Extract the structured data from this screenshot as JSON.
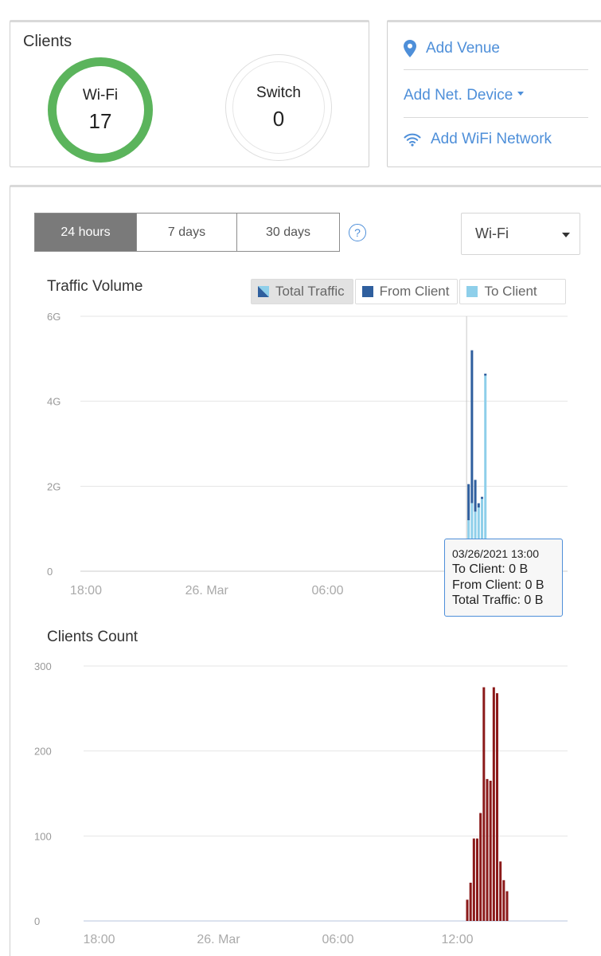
{
  "clients": {
    "title": "Clients",
    "wifi": {
      "label": "Wi-Fi",
      "count": "17",
      "color": "#5bb45c"
    },
    "switch": {
      "label": "Switch",
      "count": "0"
    }
  },
  "actions": {
    "add_venue": "Add Venue",
    "add_net_device": "Add Net. Device",
    "add_wifi_network": "Add WiFi Network",
    "link_color": "#4e8fd9"
  },
  "controls": {
    "tabs": [
      {
        "label": "24 hours",
        "active": true
      },
      {
        "label": "7 days",
        "active": false
      },
      {
        "label": "30 days",
        "active": false
      }
    ],
    "help": "?",
    "network_select": "Wi-Fi"
  },
  "traffic_chart": {
    "title": "Traffic Volume",
    "legend": [
      {
        "label": "Total Traffic",
        "active": true
      },
      {
        "label": "From Client",
        "color": "#2f5f9e"
      },
      {
        "label": "To Client",
        "color": "#8ecfea"
      }
    ],
    "tooltip": {
      "date": "03/26/2021 13:00",
      "to_client": "To Client: 0 B",
      "from_client": "From Client: 0 B",
      "total": "Total Traffic: 0 B"
    }
  },
  "clients_chart": {
    "title": "Clients Count"
  },
  "chart_data": [
    {
      "type": "bar",
      "title": "Traffic Volume",
      "x_unit": "hour",
      "x_axis_start": "2021-03-25 16:30",
      "x_ticks": [
        {
          "at": "2021-03-25 18:00",
          "label": "18:00"
        },
        {
          "at": "2021-03-26 00:00",
          "label": "26. Mar"
        },
        {
          "at": "2021-03-26 06:00",
          "label": "06:00"
        }
      ],
      "y_ticks": [
        {
          "value": 0,
          "label": "0"
        },
        {
          "value": 2,
          "label": "2G"
        },
        {
          "value": 4,
          "label": "4G"
        },
        {
          "value": 6,
          "label": "6G"
        }
      ],
      "ylim": [
        0,
        6
      ],
      "crosshair_at": "2021-03-26 13:00",
      "series": [
        {
          "name": "From Client",
          "color": "#2f5f9e",
          "points": [
            {
              "x": "2021-03-26 13:00",
              "y": 0.85
            },
            {
              "x": "2021-03-26 13:10",
              "y": 3.6
            },
            {
              "x": "2021-03-26 13:20",
              "y": 0.75
            },
            {
              "x": "2021-03-26 13:30",
              "y": 0.1
            },
            {
              "x": "2021-03-26 13:40",
              "y": 0.05
            },
            {
              "x": "2021-03-26 13:50",
              "y": 0.05
            }
          ]
        },
        {
          "name": "To Client",
          "color": "#8ecfea",
          "points": [
            {
              "x": "2021-03-26 13:00",
              "y": 1.2
            },
            {
              "x": "2021-03-26 13:10",
              "y": 1.6
            },
            {
              "x": "2021-03-26 13:20",
              "y": 1.4
            },
            {
              "x": "2021-03-26 13:30",
              "y": 1.5
            },
            {
              "x": "2021-03-26 13:40",
              "y": 1.7
            },
            {
              "x": "2021-03-26 13:50",
              "y": 4.6
            },
            {
              "x": "2021-03-26 14:00",
              "y": 0.3
            }
          ]
        }
      ]
    },
    {
      "type": "bar",
      "title": "Clients Count",
      "x_unit": "hour",
      "x_axis_start": "2021-03-25 16:30",
      "x_ticks": [
        {
          "at": "2021-03-25 18:00",
          "label": "18:00"
        },
        {
          "at": "2021-03-26 00:00",
          "label": "26. Mar"
        },
        {
          "at": "2021-03-26 06:00",
          "label": "06:00"
        },
        {
          "at": "2021-03-26 12:00",
          "label": "12:00"
        }
      ],
      "y_ticks": [
        {
          "value": 0,
          "label": "0"
        },
        {
          "value": 100,
          "label": "100"
        },
        {
          "value": 200,
          "label": "200"
        },
        {
          "value": 300,
          "label": "300"
        }
      ],
      "ylim": [
        0,
        300
      ],
      "series": [
        {
          "name": "Clients",
          "color": "#8b1a1a",
          "points": [
            {
              "x": "2021-03-26 12:30",
              "y": 25
            },
            {
              "x": "2021-03-26 12:40",
              "y": 45
            },
            {
              "x": "2021-03-26 12:50",
              "y": 97
            },
            {
              "x": "2021-03-26 13:00",
              "y": 97
            },
            {
              "x": "2021-03-26 13:10",
              "y": 127
            },
            {
              "x": "2021-03-26 13:20",
              "y": 275
            },
            {
              "x": "2021-03-26 13:30",
              "y": 167
            },
            {
              "x": "2021-03-26 13:40",
              "y": 165
            },
            {
              "x": "2021-03-26 13:50",
              "y": 275
            },
            {
              "x": "2021-03-26 14:00",
              "y": 268
            },
            {
              "x": "2021-03-26 14:10",
              "y": 70
            },
            {
              "x": "2021-03-26 14:20",
              "y": 48
            },
            {
              "x": "2021-03-26 14:30",
              "y": 35
            }
          ]
        }
      ]
    }
  ]
}
